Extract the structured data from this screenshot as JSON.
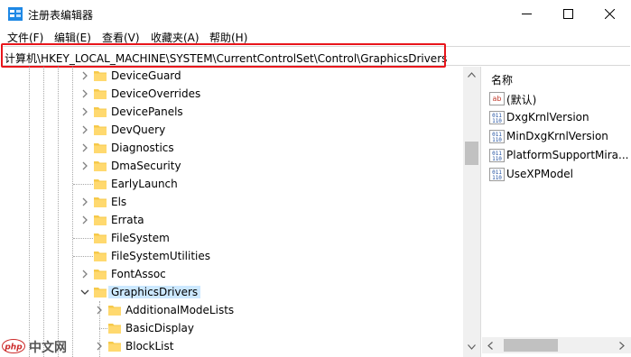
{
  "window": {
    "title": "注册表编辑器",
    "controls": [
      "minimize",
      "maximize",
      "close"
    ]
  },
  "menu": [
    {
      "label": "文件(F)"
    },
    {
      "label": "编辑(E)"
    },
    {
      "label": "查看(V)"
    },
    {
      "label": "收藏夹(A)"
    },
    {
      "label": "帮助(H)"
    }
  ],
  "address": {
    "path": "计算机\\HKEY_LOCAL_MACHINE\\SYSTEM\\CurrentControlSet\\Control\\GraphicsDrivers",
    "highlight_color": "#e8151b"
  },
  "tree": {
    "items": [
      {
        "label": "DeviceGuard",
        "expander": true
      },
      {
        "label": "DeviceOverrides",
        "expander": true
      },
      {
        "label": "DevicePanels",
        "expander": true
      },
      {
        "label": "DevQuery",
        "expander": true
      },
      {
        "label": "Diagnostics",
        "expander": true
      },
      {
        "label": "DmaSecurity",
        "expander": true
      },
      {
        "label": "EarlyLaunch",
        "expander": false
      },
      {
        "label": "Els",
        "expander": true
      },
      {
        "label": "Errata",
        "expander": true
      },
      {
        "label": "FileSystem",
        "expander": false
      },
      {
        "label": "FileSystemUtilities",
        "expander": false
      },
      {
        "label": "FontAssoc",
        "expander": true
      },
      {
        "label": "GraphicsDrivers",
        "expander": "expanded",
        "selected": true
      },
      {
        "label": "AdditionalModeLists",
        "expander": true,
        "child": true
      },
      {
        "label": "BasicDisplay",
        "expander": false,
        "child": true
      },
      {
        "label": "BlockList",
        "expander": true,
        "child": true
      }
    ]
  },
  "values_pane": {
    "column_header": "名称",
    "items": [
      {
        "name": "(默认)",
        "icon": "string-value-icon"
      },
      {
        "name": "DxgKrnlVersion",
        "icon": "dword-value-icon"
      },
      {
        "name": "MinDxgKrnlVersion",
        "icon": "dword-value-icon"
      },
      {
        "name": "PlatformSupportMira...",
        "icon": "dword-value-icon"
      },
      {
        "name": "UseXPModel",
        "icon": "dword-value-icon"
      }
    ]
  },
  "watermark": {
    "logo": "php",
    "text": "中文网"
  },
  "colors": {
    "selection": "#cce8ff",
    "folder": "#ffd46a",
    "accent_red": "#e8151b"
  }
}
